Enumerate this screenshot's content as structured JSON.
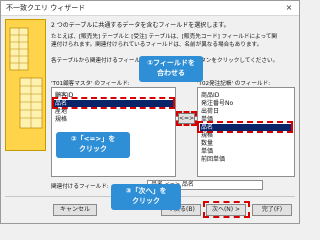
{
  "window": {
    "title": "不一致クエリ ウィザード",
    "close_label": "×"
  },
  "instructions": {
    "line1": "2 つのテーブルに共通するデータを含むフィールドを選択します。",
    "line2": "たとえば、[販売先] テーブルと [受注] テーブルは、[販売先コード] フィールドによって関",
    "line3": "連付けられます。関連付けられているフィールドは、名前が異なる場合もあります。",
    "line4": "各テーブルから関連付けるフィールドを選択して、<=> ボタンをクリックしてください。"
  },
  "left_list": {
    "label": "'T01顧客マスタ' のフィールド:",
    "items": [
      "顧客ID",
      "品名",
      "産地",
      "規格"
    ],
    "selected_index": 1
  },
  "right_list": {
    "label": "'T02発注記帳' のフィールド:",
    "items": [
      "商品ID",
      "発注番号No",
      "出荷日",
      "単価",
      "品名",
      "規格",
      "数量",
      "単価",
      "前回単価"
    ],
    "selected_index": 4
  },
  "pair_button_label": "<=>",
  "matching": {
    "label": "関連付けるフィールド:",
    "value": "品名 <=> 品名"
  },
  "buttons": {
    "cancel": "キャンセル",
    "back": "< 戻る(B)",
    "next": "次へ(N) >",
    "finish": "完了(F)"
  },
  "callouts": {
    "step1_line1": "①フィールドを",
    "step1_line2": "合わせる",
    "step2_line1": "②「<=>」を",
    "step2_line2": "クリック",
    "step3_line1": "③「次へ」を",
    "step3_line2": "クリック"
  },
  "colors": {
    "callout_blue": "#2f8fd6",
    "highlight_red": "#d60000",
    "selection_navy": "#0a246a",
    "illustration_yellow": "#ffd34a"
  }
}
